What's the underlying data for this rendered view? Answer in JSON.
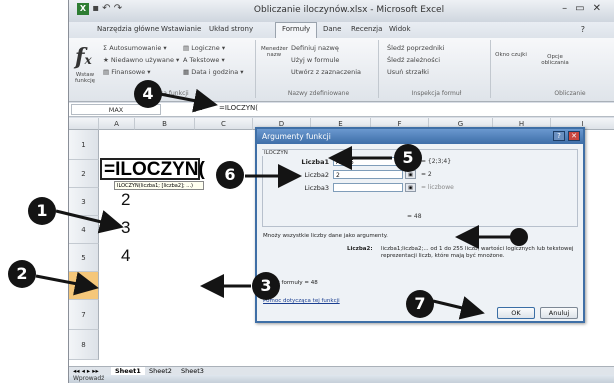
{
  "window": {
    "title": "Obliczanie iloczynów.xlsx - Microsoft Excel",
    "controls": [
      "–",
      "▭",
      "✕"
    ]
  },
  "ribbon": {
    "tabs": [
      "Narzędzia główne",
      "Wstawianie",
      "Układ strony",
      "Formuły",
      "Dane",
      "Recenzja",
      "Widok"
    ],
    "active_tab": "Formuły",
    "insert_function_label": "Wstaw funkcję",
    "function_library": {
      "autosum": "Autosumowanie",
      "recent": "Niedawno używane",
      "financial": "Finansowe",
      "logical": "Logiczne",
      "text": "Tekstowe",
      "datetime": "Data i godzina",
      "group_label": "Biblioteka funkcji"
    },
    "names": {
      "manager": "Menedżer nazw",
      "define": "Definiuj nazwę",
      "use_in_formula": "Użyj w formule",
      "create": "Utwórz z zaznaczenia",
      "group_label": "Nazwy zdefiniowane"
    },
    "auditing": {
      "trace_precedents": "Śledź poprzedniki",
      "trace_dependents": "Śledź zależności",
      "remove_arrows": "Usuń strzałki",
      "group_label": "Inspekcja formuł"
    },
    "watch_window": "Okno czujki",
    "calc": {
      "options": "Opcje obliczania",
      "group_label": "Obliczanie"
    }
  },
  "formula_bar": {
    "name_box": "MAX",
    "fx": "fx",
    "content": "=ILOCZYN("
  },
  "grid": {
    "columns": [
      "A",
      "B",
      "C",
      "D",
      "E",
      "F",
      "G",
      "H",
      "I"
    ],
    "rows": [
      "1",
      "2",
      "3",
      "4",
      "5",
      "6",
      "7",
      "8"
    ],
    "cells": {
      "A3": "2",
      "A4": "3",
      "A5": "4",
      "A6": "=ILOCZYN("
    },
    "tooltip": "ILOCZYN(liczba1; [liczba2]; ...)"
  },
  "sheet_tabs": [
    "Sheet1",
    "Sheet2",
    "Sheet3"
  ],
  "status": "Wprowadź",
  "dialog": {
    "title": "Argumenty funkcji",
    "function_name": "ILOCZYN",
    "args": [
      {
        "label": "Liczba1",
        "value": "A3:A5",
        "result": "= {2;3;4}"
      },
      {
        "label": "Liczba2",
        "value": "2",
        "result": "= 2"
      },
      {
        "label": "Liczba3",
        "value": "",
        "result": "= liczbowe"
      }
    ],
    "result_total": "= 48",
    "description": "Mnoży wszystkie liczby dane jako argumenty.",
    "param_name": "Liczba2:",
    "param_desc": "liczba1;liczba2;... od 1 do 255 liczb, wartości logicznych lub tekstowej reprezentacji liczb, które mają być mnożone.",
    "formula_result": "Wynik formuły = 48",
    "help_link": "Pomoc dotycząca tej funkcji",
    "ok": "OK",
    "cancel": "Anuluj"
  },
  "callouts": [
    "1",
    "2",
    "3",
    "4",
    "5",
    "6",
    "7"
  ]
}
